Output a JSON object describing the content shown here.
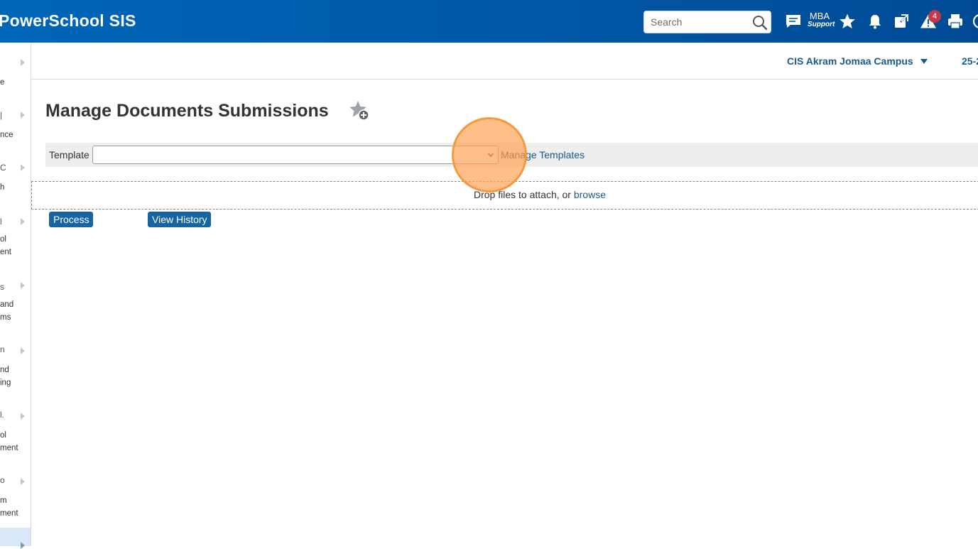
{
  "header": {
    "app_title": "PowerSchool SIS",
    "search_placeholder": "Search",
    "mba_line1": "MBA",
    "mba_line2": "Support",
    "alert_count": "4",
    "icons": [
      "messages-icon",
      "star-icon",
      "bell-icon",
      "external-link-icon",
      "alert-icon",
      "printer-icon"
    ]
  },
  "sidebar": {
    "items": [
      {
        "glyph": "",
        "label": "e"
      },
      {
        "glyph": "|",
        "label": "nce"
      },
      {
        "glyph": "C",
        "label": "h"
      },
      {
        "glyph": "l",
        "label": "ol\nent"
      },
      {
        "glyph": "s",
        "label": "and\nms"
      },
      {
        "glyph": "n",
        "label": "nd\ning"
      },
      {
        "glyph": "l.",
        "label": "ol\nment"
      },
      {
        "glyph": "o",
        "label": "m\nment"
      },
      {
        "glyph": "",
        "label": ""
      }
    ]
  },
  "topbar": {
    "campus": "CIS Akram Jomaa Campus",
    "term": "25-2"
  },
  "main": {
    "title": "Manage Documents Submissions",
    "template_label": "Template",
    "template_value": "",
    "manage_prefix": "Mana",
    "manage_link": "ge Templates",
    "drop_prefix": "Drop files to attach, or ",
    "drop_link": "browse",
    "process_label": "Process",
    "view_history_label": "View History"
  },
  "colors": {
    "header_bg": "#0058a8",
    "link": "#1a5a8a",
    "button_bg": "#1664a0",
    "click_indicator": "#f39a3e",
    "badge": "#c33a4b"
  }
}
